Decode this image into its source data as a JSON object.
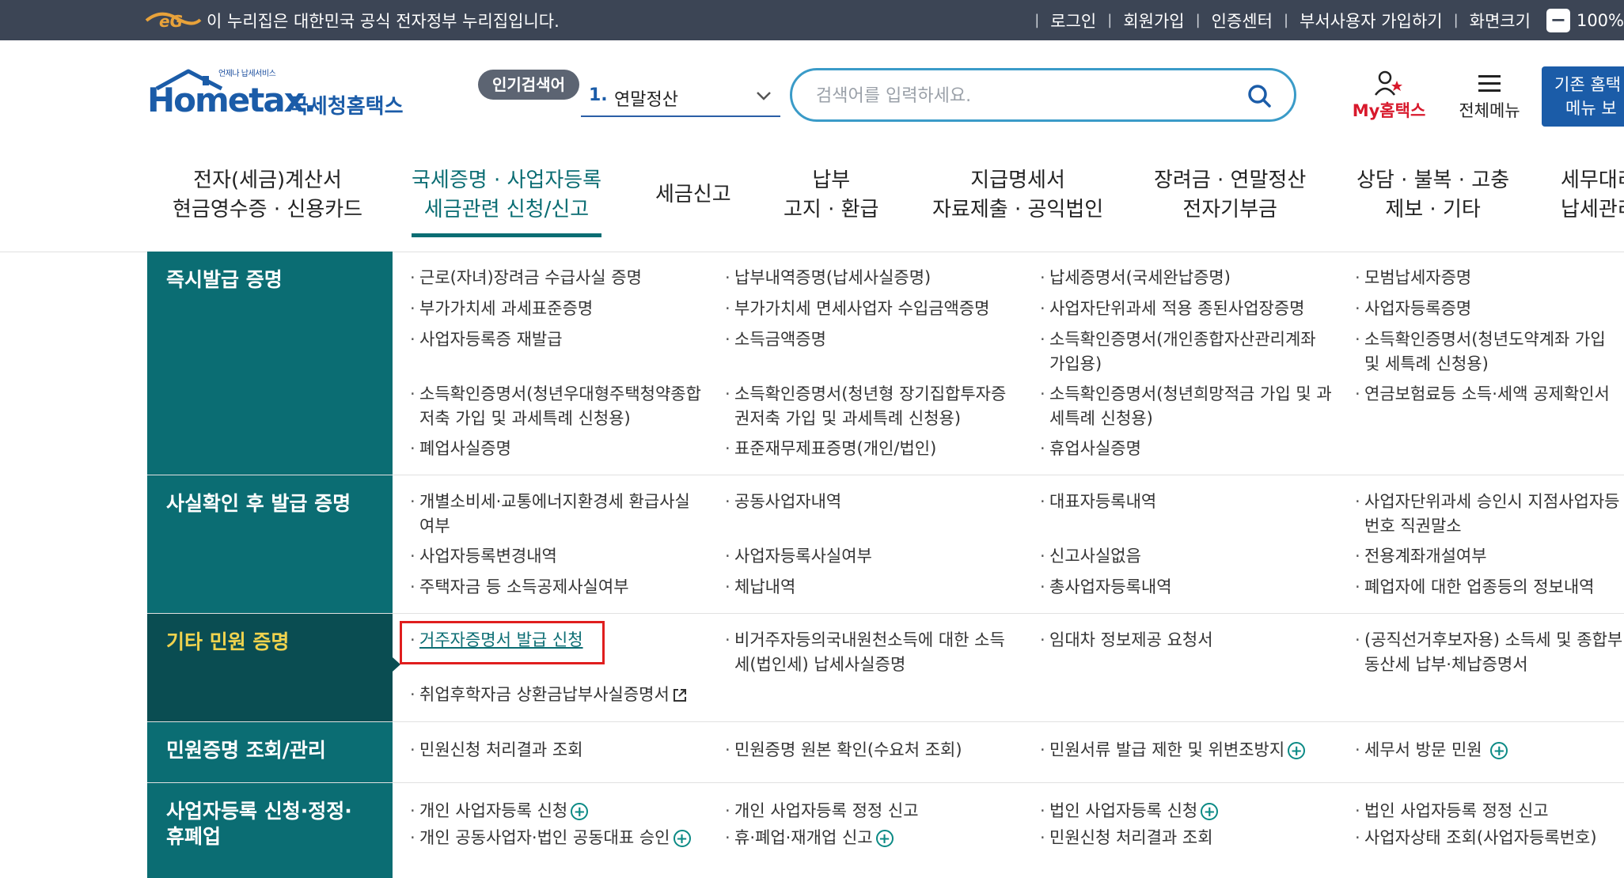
{
  "govbar": {
    "notice": "이 누리집은 대한민국 공식 전자정부 누리집입니다.",
    "links": [
      "로그인",
      "회원가입",
      "인증센터",
      "부서사용자 가입하기",
      "화면크기"
    ],
    "zoom_value": "100%"
  },
  "header": {
    "logo_small": "언제나 납세서비스",
    "logo_main": "Hometax.",
    "logo_kr": "국세청홈택스",
    "popular_label": "인기검색어",
    "popular_num": "1.",
    "popular_term": "연말정산",
    "search_placeholder": "검색어를 입력하세요.",
    "my_hometax": "My홈택스",
    "all_menu": "전체메뉴",
    "classic_btn_line1": "기존 홈택",
    "classic_btn_line2": "메뉴 보"
  },
  "gnb": [
    {
      "line1": "전자(세금)계산서",
      "line2": "현금영수증 · 신용카드"
    },
    {
      "line1": "국세증명 · 사업자등록",
      "line2": "세금관련 신청/신고",
      "active": true
    },
    {
      "line1": "세금신고",
      "line2": ""
    },
    {
      "line1": "납부",
      "line2": "고지 · 환급"
    },
    {
      "line1": "지급명세서",
      "line2": "자료제출 · 공익법인"
    },
    {
      "line1": "장려금 · 연말정산",
      "line2": "전자기부금"
    },
    {
      "line1": "상담 · 불복 · 고충",
      "line2": "제보 · 기타"
    },
    {
      "line1": "세무대리",
      "line2": "납세관리"
    }
  ],
  "sections": [
    {
      "title": "즉시발급 증명",
      "items": [
        "근로(자녀)장려금 수급사실 증명",
        "납부내역증명(납세사실증명)",
        "납세증명서(국세완납증명)",
        "모범납세자증명",
        "부가가치세 과세표준증명",
        "부가가치세 면세사업자 수입금액증명",
        "사업자단위과세 적용 종된사업장증명",
        "사업자등록증명",
        "사업자등록증 재발급",
        "소득금액증명",
        "소득확인증명서(개인종합자산관리계좌 가입용)",
        "소득확인증명서(청년도약계좌 가입 및 세특례 신청용)",
        "소득확인증명서(청년우대형주택청약종합저축 가입 및 과세특례 신청용)",
        "소득확인증명서(청년형 장기집합투자증권저축 가입 및 과세특례 신청용)",
        "소득확인증명서(청년희망적금 가입 및 과세특례 신청용)",
        "연금보험료등 소득·세액 공제확인서",
        "폐업사실증명",
        "표준재무제표증명(개인/법인)",
        "휴업사실증명"
      ]
    },
    {
      "title": "사실확인 후 발급 증명",
      "items": [
        "개별소비세·교통에너지환경세 환급사실 여부",
        "공동사업자내역",
        "대표자등록내역",
        "사업자단위과세 승인시 지점사업자등번호 직권말소",
        "사업자등록변경내역",
        "사업자등록사실여부",
        "신고사실없음",
        "전용계좌개설여부",
        "주택자금 등 소득공제사실여부",
        "체납내역",
        "총사업자등록내역",
        "폐업자에 대한 업종등의 정보내역"
      ]
    },
    {
      "title": "기타 민원 증명",
      "items": [
        "거주자증명서 발급 신청",
        "비거주자등의국내원천소득에 대한 소득세(법인세) 납세사실증명",
        "임대차 정보제공 요청서",
        "(공직선거후보자용) 소득세 및 종합부동산세 납부·체납증명서",
        "취업후학자금 상환금납부사실증명서"
      ]
    },
    {
      "title": "민원증명 조회/관리",
      "items": [
        "민원신청 처리결과 조회",
        "민원증명 원본 확인(수요처 조회)",
        "민원서류 발급 제한 및 위변조방지",
        "세무서 방문 민원"
      ]
    },
    {
      "title": "사업자등록 신청·정정·휴폐업",
      "items": [
        "개인 사업자등록 신청",
        "개인 사업자등록 정정 신고",
        "법인 사업자등록 신청",
        "법인 사업자등록 정정 신고",
        "개인 공동사업자·법인 공동대표 승인",
        "휴·폐업·재개업 신고",
        "민원신청 처리결과 조회",
        "사업자상태 조회(사업자등록번호)"
      ]
    }
  ]
}
